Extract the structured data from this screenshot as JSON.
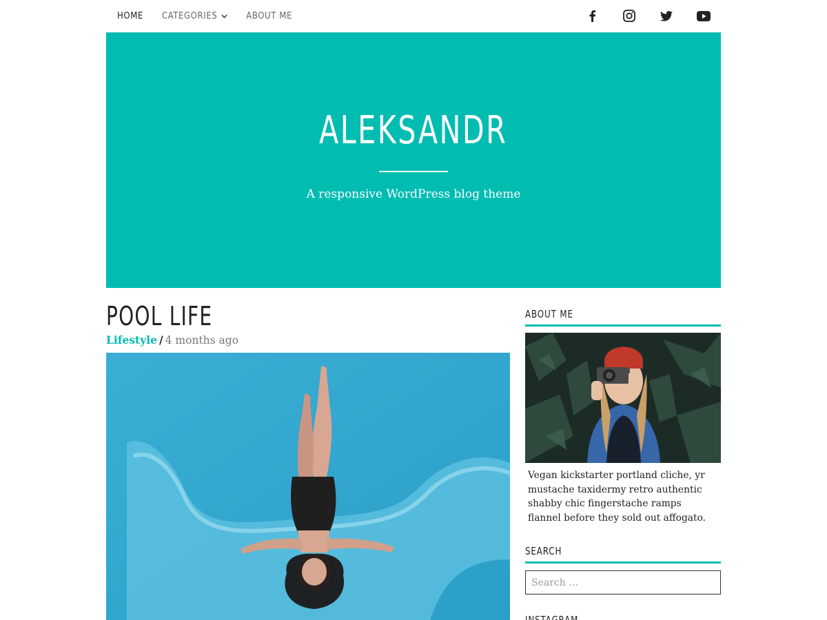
{
  "colors": {
    "accent": "#00bcb1",
    "text": "#222222",
    "muted": "#777777"
  },
  "nav": {
    "items": [
      {
        "label": "HOME"
      },
      {
        "label": "CATEGORIES"
      },
      {
        "label": "ABOUT ME"
      }
    ],
    "social": [
      "facebook-icon",
      "instagram-icon",
      "twitter-icon",
      "youtube-icon"
    ]
  },
  "hero": {
    "title": "ALEKSANDR",
    "tagline": "A responsive WordPress blog theme"
  },
  "post": {
    "title": "POOL LIFE",
    "category": "Lifestyle",
    "separator": "/",
    "date": "4 months ago"
  },
  "sidebar": {
    "about_title": "ABOUT ME",
    "about_text": "Vegan kickstarter portland cliche, yr mustache taxidermy retro authentic shabby chic fingerstache ramps flannel before they sold out affogato.",
    "search_title": "SEARCH",
    "search_placeholder": "Search …",
    "instagram_title": "INSTAGRAM"
  }
}
